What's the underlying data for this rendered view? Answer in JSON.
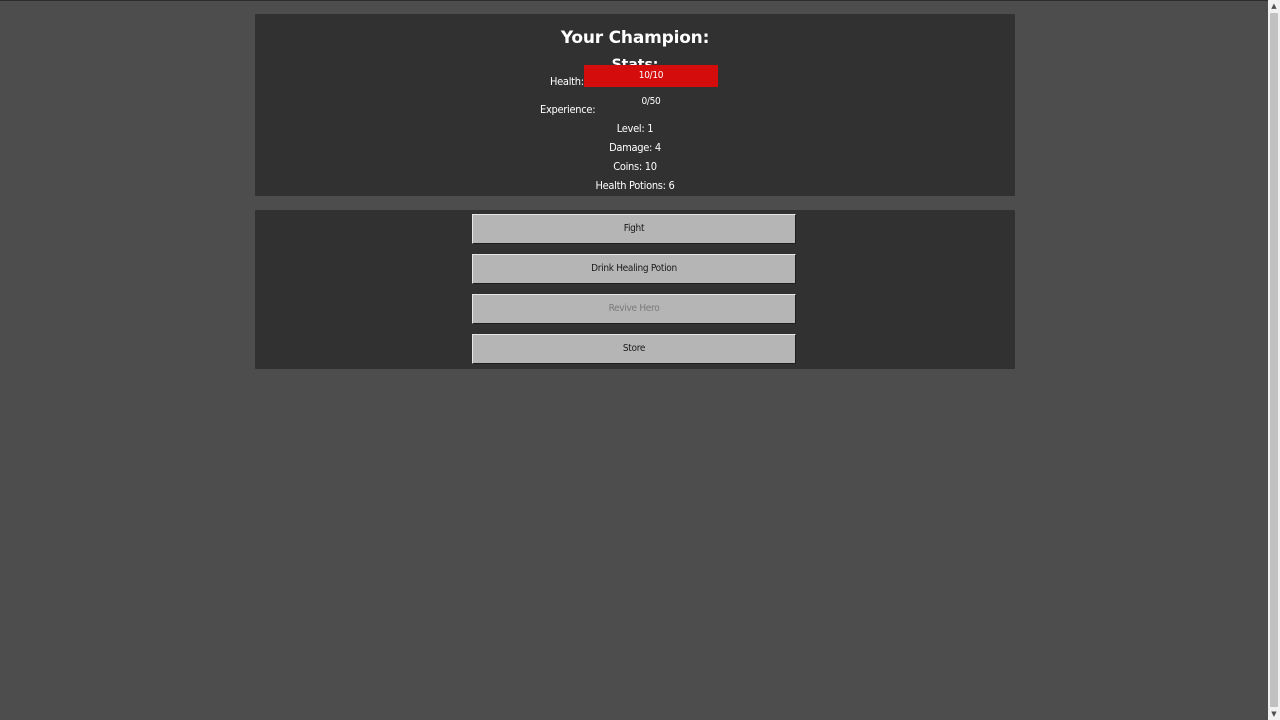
{
  "champion_panel": {
    "title": "Your Champion:",
    "subtitle": "Stats:",
    "health": {
      "label": "Health:",
      "text": "10/10",
      "fill_fraction": 1.0,
      "color": "#d40c0c"
    },
    "experience": {
      "label": "Experience:",
      "text": "0/50",
      "fill_fraction": 0.0,
      "color": "#2f9a2f"
    },
    "level": "Level: 1",
    "damage": "Damage: 4",
    "coins": "Coins: 10",
    "health_potions": "Health Potions: 6"
  },
  "actions": [
    {
      "label": "Fight",
      "enabled": true
    },
    {
      "label": "Drink Healing Potion",
      "enabled": true
    },
    {
      "label": "Revive Hero",
      "enabled": false
    },
    {
      "label": "Store",
      "enabled": true
    }
  ],
  "colors": {
    "page_background": "#4d4d4d",
    "panel_background": "#313131",
    "button_background": "#b5b5b5"
  },
  "icons": {
    "scroll_up": "▲",
    "scroll_down": "▼"
  }
}
